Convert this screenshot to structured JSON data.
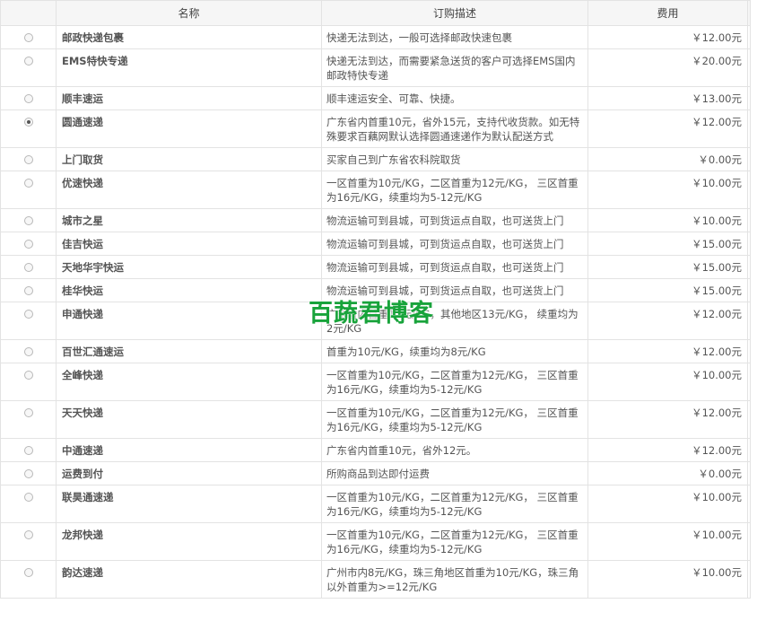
{
  "headers": {
    "radio": "",
    "name": "名称",
    "desc": "订购描述",
    "fee": "费用"
  },
  "rows": [
    {
      "name": "邮政快递包裹",
      "desc": "快递无法到达，一般可选择邮政快速包裹",
      "fee": "￥12.00元",
      "selected": false
    },
    {
      "name": "EMS特快专递",
      "desc": "快递无法到达，而需要紧急送货的客户可选择EMS国内邮政特快专递",
      "fee": "￥20.00元",
      "selected": false
    },
    {
      "name": "顺丰速运",
      "desc": "顺丰速运安全、可靠、快捷。",
      "fee": "￥13.00元",
      "selected": false
    },
    {
      "name": "圆通速递",
      "desc": "广东省内首重10元，省外15元，支持代收货款。如无特殊要求百藕网默认选择圆通速递作为默认配送方式",
      "fee": "￥12.00元",
      "selected": true
    },
    {
      "name": "上门取货",
      "desc": "买家自己到广东省农科院取货",
      "fee": "￥0.00元",
      "selected": false
    },
    {
      "name": "优速快递",
      "desc": "一区首重为10元/KG，二区首重为12元/KG， 三区首重为16元/KG，续重均为5-12元/KG",
      "fee": "￥10.00元",
      "selected": false
    },
    {
      "name": "城市之星",
      "desc": "物流运输可到县城，可到货运点自取，也可送货上门",
      "fee": "￥10.00元",
      "selected": false
    },
    {
      "name": "佳吉快运",
      "desc": "物流运输可到县城，可到货运点自取，也可送货上门",
      "fee": "￥15.00元",
      "selected": false
    },
    {
      "name": "天地华宇快运",
      "desc": "物流运输可到县城，可到货运点自取，也可送货上门",
      "fee": "￥15.00元",
      "selected": false
    },
    {
      "name": "桂华快运",
      "desc": "物流运输可到县城，可到货运点自取，也可送货上门",
      "fee": "￥15.00元",
      "selected": false
    },
    {
      "name": "申通快递",
      "desc": "广东省内首重12元/KG，其他地区13元/KG， 续重均为2元/KG",
      "fee": "￥12.00元",
      "selected": false
    },
    {
      "name": "百世汇通速运",
      "desc": "首重为10元/KG，续重均为8元/KG",
      "fee": "￥12.00元",
      "selected": false
    },
    {
      "name": "全峰快递",
      "desc": "一区首重为10元/KG，二区首重为12元/KG， 三区首重为16元/KG，续重均为5-12元/KG",
      "fee": "￥10.00元",
      "selected": false
    },
    {
      "name": "天天快递",
      "desc": "一区首重为10元/KG，二区首重为12元/KG， 三区首重为16元/KG，续重均为5-12元/KG",
      "fee": "￥12.00元",
      "selected": false
    },
    {
      "name": "中通速递",
      "desc": "广东省内首重10元，省外12元。",
      "fee": "￥12.00元",
      "selected": false
    },
    {
      "name": "运费到付",
      "desc": "所购商品到达即付运费",
      "fee": "￥0.00元",
      "selected": false
    },
    {
      "name": "联昊通速递",
      "desc": "一区首重为10元/KG，二区首重为12元/KG， 三区首重为16元/KG，续重均为5-12元/KG",
      "fee": "￥10.00元",
      "selected": false
    },
    {
      "name": "龙邦快递",
      "desc": "一区首重为10元/KG，二区首重为12元/KG， 三区首重为16元/KG，续重均为5-12元/KG",
      "fee": "￥10.00元",
      "selected": false
    },
    {
      "name": "韵达速递",
      "desc": "广州市内8元/KG，珠三角地区首重为10元/KG，珠三角以外首重为>=12元/KG",
      "fee": "￥10.00元",
      "selected": false
    }
  ],
  "watermark": "百蔬君博客"
}
